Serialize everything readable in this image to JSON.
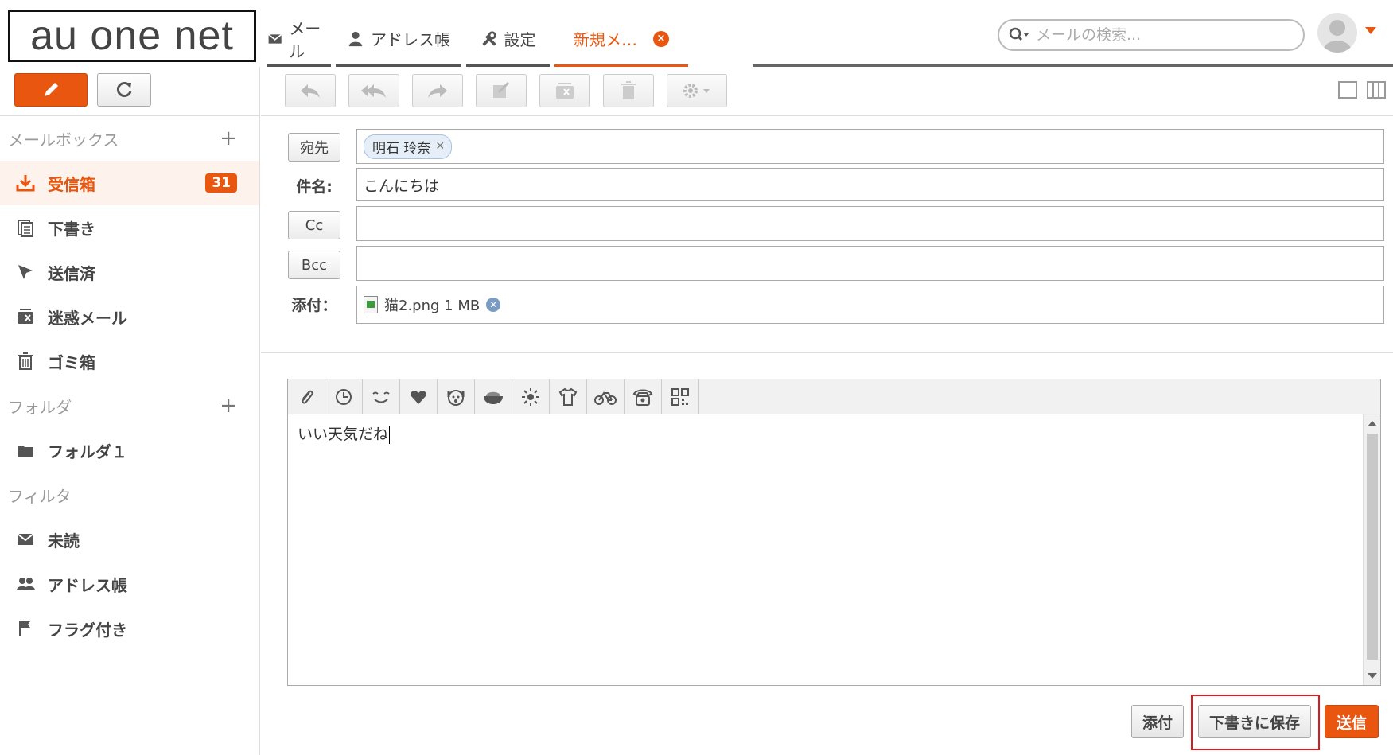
{
  "logo": {
    "text": "au one net"
  },
  "tabs": [
    {
      "label": "メール",
      "icon": "mail-icon"
    },
    {
      "label": "アドレス帳",
      "icon": "person-icon"
    },
    {
      "label": "設定",
      "icon": "tools-icon"
    },
    {
      "label": "新規メ…",
      "icon": "close-icon",
      "active": true
    }
  ],
  "search": {
    "placeholder": "メールの検索..."
  },
  "sidebar": {
    "mailbox_header": "メールボックス",
    "mailbox_items": [
      {
        "label": "受信箱",
        "icon": "inbox-download-icon",
        "count": "31",
        "selected": true
      },
      {
        "label": "下書き",
        "icon": "drafts-icon"
      },
      {
        "label": "送信済",
        "icon": "sent-cursor-icon"
      },
      {
        "label": "迷惑メール",
        "icon": "spam-icon"
      },
      {
        "label": "ゴミ箱",
        "icon": "trash-icon"
      }
    ],
    "folder_header": "フォルダ",
    "folder_items": [
      {
        "label": "フォルダ１",
        "icon": "folder-icon"
      }
    ],
    "filter_header": "フィルタ",
    "filter_items": [
      {
        "label": "未読",
        "icon": "envelope-icon"
      },
      {
        "label": "アドレス帳",
        "icon": "people-icon"
      },
      {
        "label": "フラグ付き",
        "icon": "flag-icon"
      }
    ]
  },
  "compose": {
    "to_label": "宛先",
    "to_recipient": "明石 玲奈",
    "subject_label": "件名:",
    "subject_value": "こんにちは",
    "cc_label": "Cc",
    "bcc_label": "Bcc",
    "attach_label": "添付：",
    "attachment_name": "猫2.png 1 MB",
    "body_text": "いい天気だね"
  },
  "buttons": {
    "attach": "添付",
    "save_draft": "下書きに保存",
    "send": "送信"
  },
  "colors": {
    "accent": "#e8560f",
    "highlight": "#e0191c"
  }
}
